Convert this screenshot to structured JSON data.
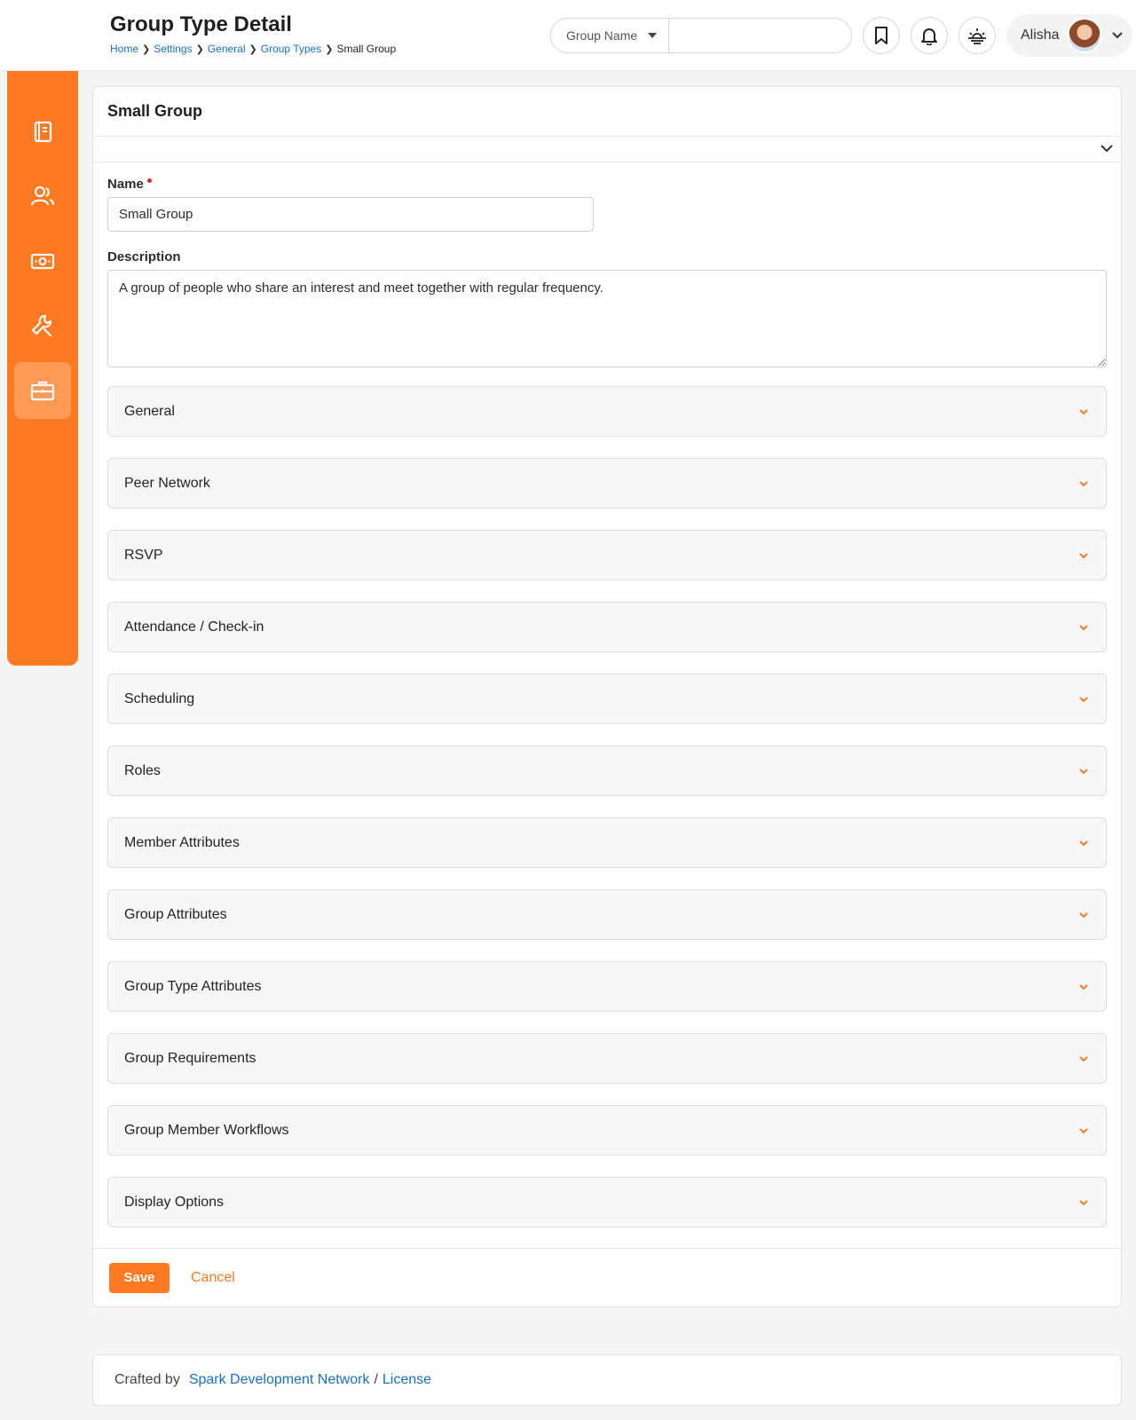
{
  "header": {
    "title": "Group Type Detail",
    "breadcrumb": [
      "Home",
      "Settings",
      "General",
      "Group Types"
    ],
    "breadcrumb_current": "Small Group",
    "search_filter": "Group Name",
    "search_placeholder": "",
    "user_name": "Alisha"
  },
  "sidebar": {
    "accent_color": "#fd7a22",
    "items": [
      {
        "icon": "notebook-icon"
      },
      {
        "icon": "people-icon"
      },
      {
        "icon": "money-icon"
      },
      {
        "icon": "wrench-icon"
      },
      {
        "icon": "briefcase-icon",
        "active": true
      }
    ]
  },
  "card": {
    "title": "Small Group",
    "name_label": "Name",
    "name_value": "Small Group",
    "description_label": "Description",
    "description_value": "A group of people who share an interest and meet together with regular frequency.",
    "sections": [
      "General",
      "Peer Network",
      "RSVP",
      "Attendance / Check-in",
      "Scheduling",
      "Roles",
      "Member Attributes",
      "Group Attributes",
      "Group Type Attributes",
      "Group Requirements",
      "Group Member Workflows",
      "Display Options"
    ],
    "save_label": "Save",
    "cancel_label": "Cancel"
  },
  "footer": {
    "prefix": "Crafted by",
    "link_org": "Spark Development Network",
    "separator": "/",
    "link_license": "License"
  }
}
